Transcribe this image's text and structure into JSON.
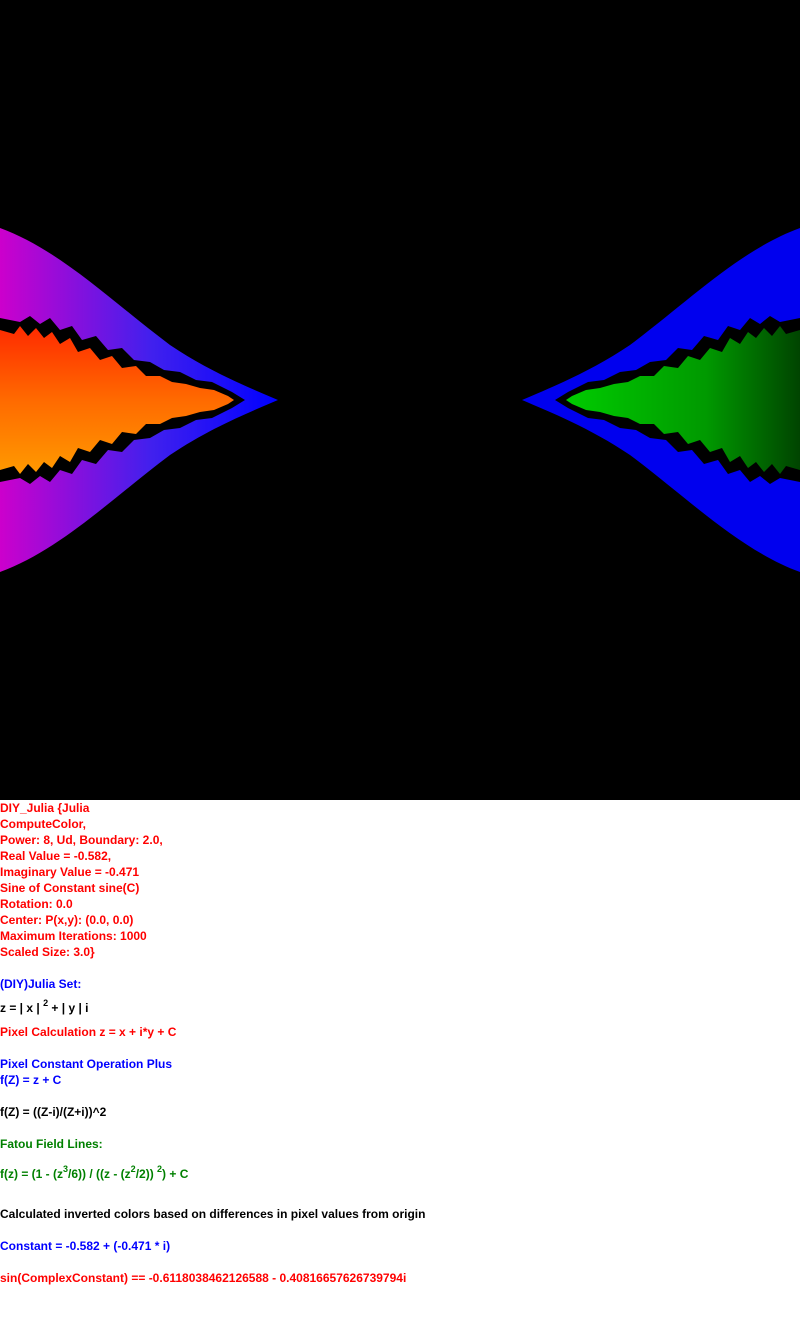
{
  "image": {
    "description_colors": {
      "background": "#000000",
      "left_outer": "#cc00cc",
      "left_outer_end": "#0000ff",
      "left_inner_top": "#ff4000",
      "left_inner_bottom": "#ff9900",
      "right_outer": "#0000ee",
      "right_inner": "#00aa00"
    }
  },
  "params": {
    "line1": "DIY_Julia {Julia",
    "line2": "ComputeColor,",
    "line3": "Power: 8, Ud, Boundary: 2.0,",
    "line4": "Real Value = -0.582,",
    "line5": "Imaginary Value = -0.471",
    "line6": "Sine of Constant sine(C)",
    "line7": "Rotation: 0.0",
    "line8": "Center: P(x,y): (0.0, 0.0)",
    "line9": "Maximum Iterations: 1000",
    "line10": "Scaled Size: 3.0}"
  },
  "set_title": "(DIY)Julia Set:",
  "z_formula": {
    "a": "z = | x | ",
    "sup": "2",
    "b": " + | y | i"
  },
  "pixel_calc": "Pixel Calculation z = x + i*y + C",
  "pixel_const_op": "Pixel Constant Operation Plus",
  "fz_plus": "f(Z) = z + C",
  "fz_mobius": "f(Z) = ((Z-i)/(Z+i))^2",
  "fatou_title": "Fatou Field Lines:",
  "fatou_formula": {
    "a": "f(z) = (1 - (z",
    "sup1": "3",
    "b": "/6)) / ((z - (z",
    "sup2": "2",
    "c": "/2)) ",
    "sup3": "2",
    "d": ") + C"
  },
  "inverted_colors": "Calculated inverted colors based on differences in pixel values from origin",
  "constant": "Constant = -0.582 + (-0.471 * i)",
  "sin_constant": "sin(ComplexConstant) == -0.6118038462126588 - 0.40816657626739794i"
}
